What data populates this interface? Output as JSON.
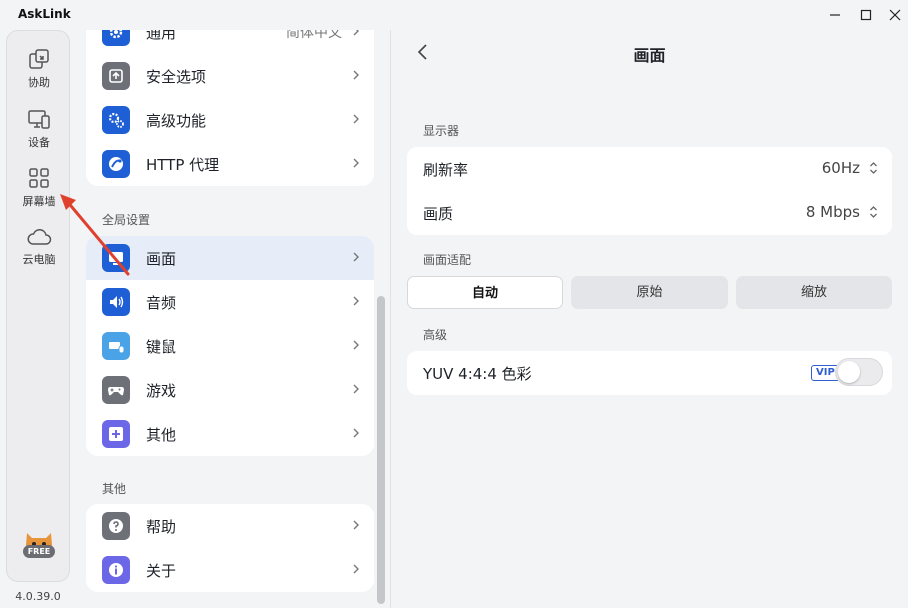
{
  "app": {
    "title": "AskLink",
    "version": "4.0.39.0"
  },
  "rail": {
    "items": [
      {
        "label": "协助",
        "icon": "assist-icon"
      },
      {
        "label": "设备",
        "icon": "device-icon"
      },
      {
        "label": "屏幕墙",
        "icon": "grid-icon"
      },
      {
        "label": "云电脑",
        "icon": "cloud-icon"
      }
    ],
    "badge": "FREE"
  },
  "settings": {
    "top_group": [
      {
        "label": "通用",
        "value": "简体中文",
        "icon": "gear-icon"
      },
      {
        "label": "安全选项",
        "icon": "upload-shield-icon"
      },
      {
        "label": "高级功能",
        "icon": "advanced-gears-icon"
      },
      {
        "label": "HTTP 代理",
        "icon": "proxy-icon"
      }
    ],
    "global_title": "全局设置",
    "global_group": [
      {
        "label": "画面",
        "icon": "display-icon",
        "active": true
      },
      {
        "label": "音频",
        "icon": "speaker-icon"
      },
      {
        "label": "键鼠",
        "icon": "keyboard-mouse-icon"
      },
      {
        "label": "游戏",
        "icon": "gamepad-icon"
      },
      {
        "label": "其他",
        "icon": "plus-box-icon"
      }
    ],
    "other_title": "其他",
    "other_group": [
      {
        "label": "帮助",
        "icon": "help-icon"
      },
      {
        "label": "关于",
        "icon": "info-icon"
      }
    ]
  },
  "panel": {
    "title": "画面",
    "display_section": "显示器",
    "refresh_label": "刷新率",
    "refresh_value": "60Hz",
    "quality_label": "画质",
    "quality_value": "8 Mbps",
    "fit_section": "画面适配",
    "fit_options": [
      "自动",
      "原始",
      "缩放"
    ],
    "fit_selected": "自动",
    "advanced_section": "高级",
    "yuv_label": "YUV 4:4:4 色彩",
    "vip_badge": "VIP",
    "yuv_enabled": false
  },
  "colors": {
    "accent_blue": "#2f5fd0",
    "icon_blue": "#1f5fd6",
    "light_blue": "#4aa3e6",
    "gray_icon": "#6e7078",
    "purple": "#6b67e6",
    "arrow_red": "#e0412d"
  }
}
